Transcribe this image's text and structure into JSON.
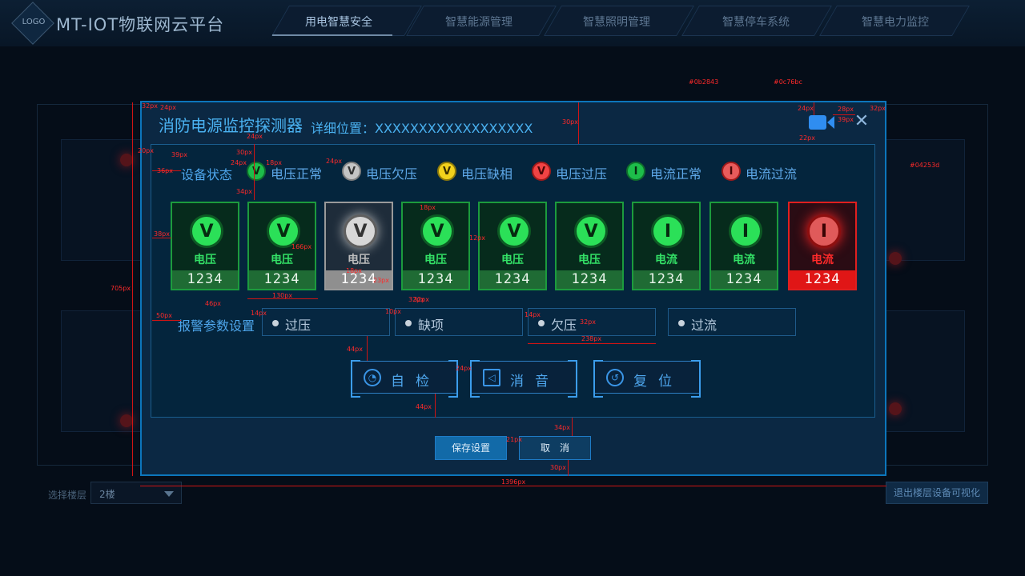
{
  "header": {
    "logo": "LOGO",
    "title": "MT-IOT物联网云平台",
    "tabs": [
      "用电智慧安全",
      "智慧能源管理",
      "智慧照明管理",
      "智慧停车系统",
      "智慧电力监控"
    ],
    "active_tab": 0
  },
  "background": {
    "floor_label": "选择楼层",
    "floor_value": "2楼",
    "exit_button": "退出楼层设备可视化"
  },
  "modal": {
    "title": "消防电源监控探测器",
    "location": "详细位置：XXXXXXXXXXXXXXXXXX",
    "status_label": "设备状态",
    "legend": [
      {
        "glyph": "V",
        "label": "电压正常",
        "color": "green"
      },
      {
        "glyph": "V",
        "label": "电压欠压",
        "color": "gray"
      },
      {
        "glyph": "V",
        "label": "电压缺相",
        "color": "yellow"
      },
      {
        "glyph": "V",
        "label": "电压过压",
        "color": "red"
      },
      {
        "glyph": "I",
        "label": "电流正常",
        "color": "green"
      },
      {
        "glyph": "I",
        "label": "电流过流",
        "color": "red"
      }
    ],
    "cards": [
      {
        "glyph": "V",
        "name": "电压",
        "value": "1234",
        "state": "green"
      },
      {
        "glyph": "V",
        "name": "电压",
        "value": "1234",
        "state": "green"
      },
      {
        "glyph": "V",
        "name": "电压",
        "value": "1234",
        "state": "gray"
      },
      {
        "glyph": "V",
        "name": "电压",
        "value": "1234",
        "state": "green"
      },
      {
        "glyph": "V",
        "name": "电压",
        "value": "1234",
        "state": "green"
      },
      {
        "glyph": "V",
        "name": "电压",
        "value": "1234",
        "state": "green"
      },
      {
        "glyph": "I",
        "name": "电流",
        "value": "1234",
        "state": "green"
      },
      {
        "glyph": "I",
        "name": "电流",
        "value": "1234",
        "state": "green"
      },
      {
        "glyph": "I",
        "name": "电流",
        "value": "1234",
        "state": "red"
      }
    ],
    "alarm_label": "报警参数设置",
    "alarm_params": [
      "过压",
      "缺项",
      "欠压",
      "过流"
    ],
    "actions": [
      {
        "label": "自检",
        "icon": "gauge-icon"
      },
      {
        "label": "消音",
        "icon": "mute-icon"
      },
      {
        "label": "复位",
        "icon": "reset-icon"
      }
    ],
    "save_button": "保存设置",
    "cancel_button": "取消"
  },
  "annotations": {
    "colors": [
      "#0b2843",
      "#0c76bc",
      "#04253d"
    ],
    "texts": [
      "32px",
      "24px",
      "24px",
      "28px",
      "32px",
      "39px",
      "22px",
      "30px",
      "20px",
      "39px",
      "36px",
      "24px",
      "30px",
      "24px",
      "18px",
      "24px",
      "34px",
      "38px",
      "18px",
      "12px",
      "166px",
      "18px",
      "32px",
      "130px",
      "23px",
      "46px",
      "50px",
      "14px",
      "10px",
      "32px",
      "14px",
      "32px",
      "238px",
      "44px",
      "24px",
      "44px",
      "21px",
      "34px",
      "30px",
      "705px",
      "1396px"
    ]
  }
}
